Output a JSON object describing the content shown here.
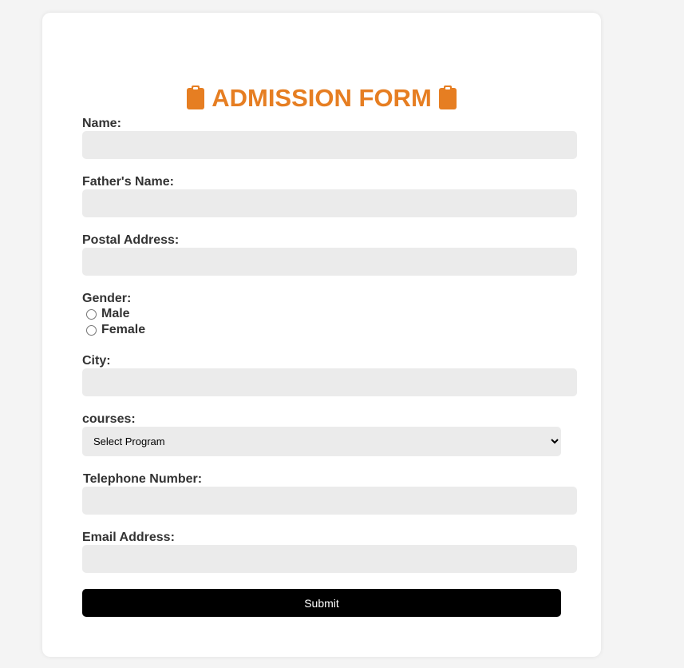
{
  "colors": {
    "accent": "#e67e22",
    "page_background": "#f4f4f4",
    "card_background": "#ffffff",
    "input_background": "#ebebeb",
    "label_text": "#333333",
    "button_background": "#000000",
    "button_text": "#ffffff"
  },
  "form": {
    "title": "ADMISSION FORM",
    "title_icon": "clipboard-icon",
    "fields": {
      "name": {
        "label": "Name:",
        "value": ""
      },
      "father_name": {
        "label": "Father's Name:",
        "value": ""
      },
      "postal_address": {
        "label": "Postal Address:",
        "value": ""
      },
      "city": {
        "label": "City:",
        "value": ""
      },
      "telephone": {
        "label": "Telephone Number:",
        "value": ""
      },
      "email": {
        "label": "Email Address:",
        "value": ""
      }
    },
    "gender": {
      "label": "Gender:",
      "options": [
        "Male",
        "Female"
      ],
      "selected": null
    },
    "courses": {
      "label": "courses:",
      "selected": "Select Program",
      "options": [
        "Select Program"
      ]
    },
    "submit_label": "Submit"
  }
}
